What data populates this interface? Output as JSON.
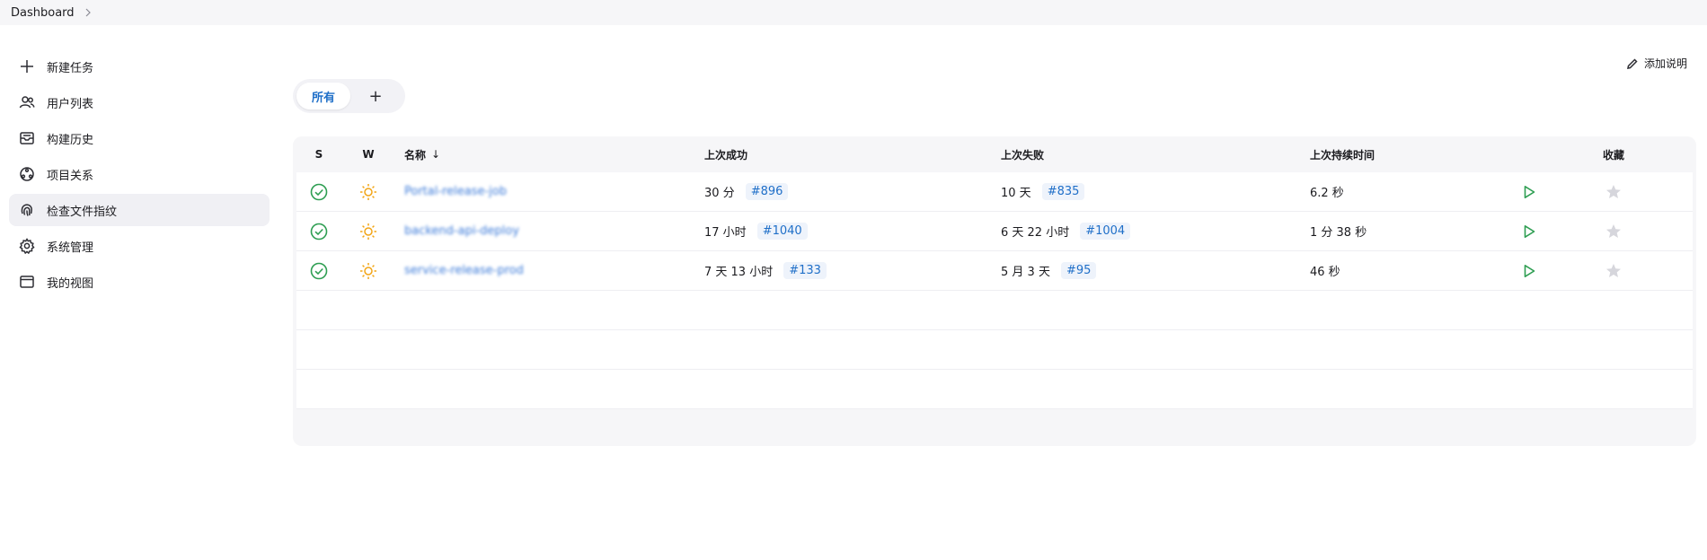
{
  "breadcrumb": {
    "root": "Dashboard"
  },
  "sidebar": {
    "items": [
      {
        "label": "新建任务",
        "icon": "plus-icon"
      },
      {
        "label": "用户列表",
        "icon": "users-icon"
      },
      {
        "label": "构建历史",
        "icon": "history-icon"
      },
      {
        "label": "项目关系",
        "icon": "relations-icon"
      },
      {
        "label": "检查文件指纹",
        "icon": "fingerprint-icon",
        "active": true
      },
      {
        "label": "系统管理",
        "icon": "gear-icon"
      },
      {
        "label": "我的视图",
        "icon": "window-icon"
      }
    ]
  },
  "header": {
    "add_description": "添加说明"
  },
  "tabs": {
    "all": "所有",
    "add": "+"
  },
  "table": {
    "headers": {
      "s": "S",
      "w": "W",
      "name": "名称",
      "sort_arrow": "↓",
      "last_success": "上次成功",
      "last_failure": "上次失败",
      "last_duration": "上次持续时间",
      "favorite": "收藏"
    },
    "rows": [
      {
        "name": "Portal-release-job",
        "success_time": "30 分",
        "success_build": "#896",
        "failure_time": "10 天",
        "failure_build": "#835",
        "duration": "6.2 秒"
      },
      {
        "name": "backend-api-deploy",
        "success_time": "17 小时",
        "success_build": "#1040",
        "failure_time": "6 天 22 小时",
        "failure_build": "#1004",
        "duration": "1 分 38 秒"
      },
      {
        "name": "service-release-prod",
        "success_time": "7 天 13 小时",
        "success_build": "#133",
        "failure_time": "5 月 3 天",
        "failure_build": "#95",
        "duration": "46 秒"
      }
    ]
  },
  "colors": {
    "accent": "#1f6fc8",
    "success": "#2e9e52",
    "weather": "#f2a516",
    "star": "#c8c8d0"
  }
}
